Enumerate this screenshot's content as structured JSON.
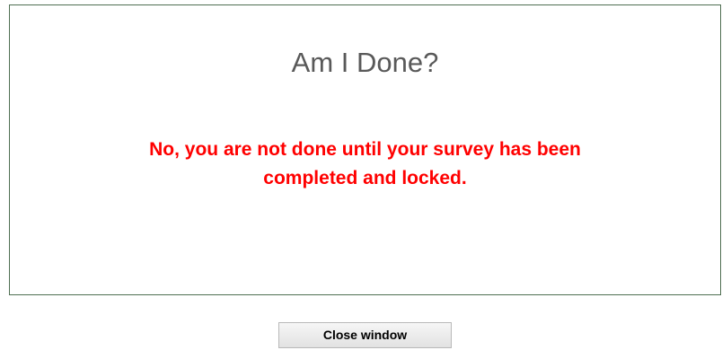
{
  "dialog": {
    "title": "Am I Done?",
    "message_line1": "No, you are not done until your survey has been",
    "message_line2": "completed and locked.",
    "message_color": "#ff0000"
  },
  "actions": {
    "close_label": "Close window"
  }
}
